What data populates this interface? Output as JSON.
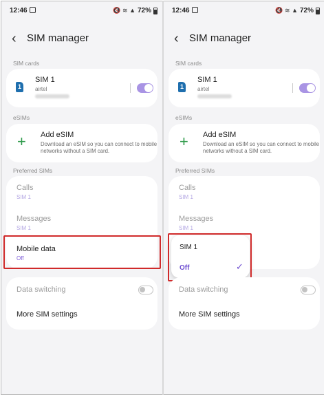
{
  "status_bar": {
    "time": "12:46",
    "battery": "72%",
    "signal_icons": "🔇 ≋ ▲"
  },
  "header": {
    "title": "SIM manager"
  },
  "sections": {
    "sim_cards": "SIM cards",
    "esims": "eSIMs",
    "preferred": "Preferred SIMs"
  },
  "sim_card": {
    "name": "SIM 1",
    "carrier": "airtel",
    "enabled": true,
    "icon_label": "1"
  },
  "add_esim": {
    "title": "Add eSIM",
    "description": "Download an eSIM so you can connect to mobile networks without a SIM card."
  },
  "preferred_items": {
    "calls": {
      "title": "Calls",
      "value": "SIM 1"
    },
    "messages": {
      "title": "Messages",
      "value": "SIM 1"
    },
    "mobile_data": {
      "title": "Mobile data",
      "value": "Off"
    }
  },
  "data_switching": {
    "label": "Data switching",
    "enabled": false
  },
  "more_settings": {
    "label": "More SIM settings"
  },
  "popup": {
    "options": [
      "SIM 1",
      "Off"
    ],
    "selected": "Off"
  },
  "colors": {
    "accent": "#7a59d6",
    "highlight": "#d02a2a",
    "toggle_on": "#a994e4"
  }
}
